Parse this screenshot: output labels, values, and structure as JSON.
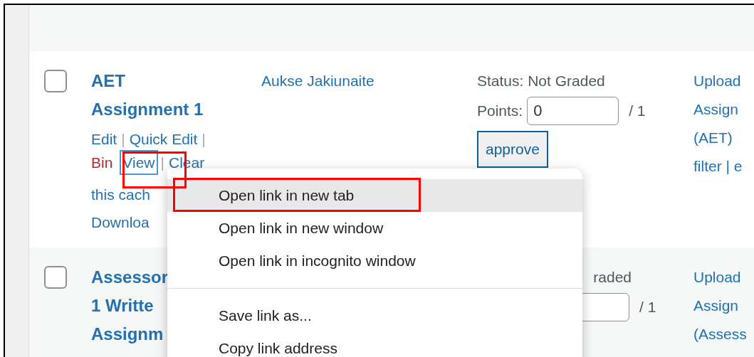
{
  "rows": [
    {
      "checked": false,
      "title_lines": [
        "AET",
        "Assignment 1"
      ],
      "author": "Aukse Jakiunaite",
      "action_lines": [
        [
          {
            "label": "Edit",
            "kind": "link",
            "focused": false
          },
          {
            "label": "|",
            "kind": "separator",
            "focused": false
          },
          {
            "label": "Quick Edit",
            "kind": "link",
            "focused": false
          },
          {
            "label": "|",
            "kind": "separator",
            "focused": false
          }
        ],
        [
          {
            "label": "Bin",
            "kind": "delete",
            "focused": false
          },
          {
            "label": "View",
            "kind": "link",
            "focused": true
          },
          {
            "label": "|",
            "kind": "separator",
            "focused": false
          },
          {
            "label": "Clear",
            "kind": "link",
            "focused": false
          }
        ],
        [
          {
            "label": "this cach",
            "kind": "link",
            "focused": false
          }
        ],
        [
          {
            "label": "Downloa",
            "kind": "link",
            "focused": false
          }
        ]
      ],
      "status": "Status: Not Graded",
      "points_label": "Points:",
      "points_value": "0",
      "points_max": "/ 1",
      "approve_button": "approve",
      "column_5": [
        "Upload",
        "Assign",
        "(AET)",
        "filter | e"
      ]
    },
    {
      "checked": false,
      "title_lines": [
        "Assessor",
        "1 Writte",
        "Assignm"
      ],
      "status": "raded",
      "points_max": "/ 1",
      "column_5": [
        "Upload",
        "Assign",
        "(Assess"
      ]
    }
  ],
  "context_menu": {
    "items": [
      {
        "label": "Open link in new tab",
        "selected": true
      },
      {
        "label": "Open link in new window",
        "selected": false
      },
      {
        "label": "Open link in incognito window",
        "selected": false
      },
      {
        "label": "Save link as...",
        "selected": false,
        "separator_before": true
      },
      {
        "label": "Copy link address",
        "selected": false
      }
    ]
  }
}
